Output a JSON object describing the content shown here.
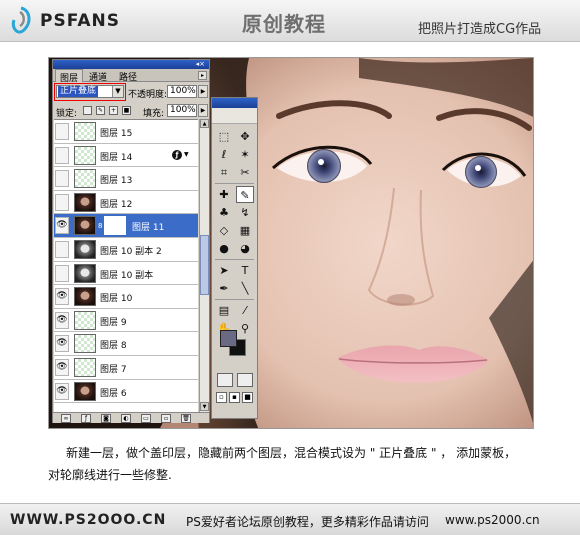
{
  "header": {
    "logo": "PSFANS",
    "title": "原创教程",
    "subtitle": "把照片打造成CG作品"
  },
  "layers_panel": {
    "tabs": [
      "图层",
      "通道",
      "路径"
    ],
    "blend_mode": "正片叠底",
    "opacity_label": "不透明度:",
    "opacity_value": "100%",
    "lock_label": "锁定:",
    "fill_label": "填充:",
    "fill_value": "100%",
    "layers": [
      {
        "name": "图层 15",
        "visible": false,
        "thumb": "checker",
        "selected": false
      },
      {
        "name": "图层 14",
        "visible": false,
        "thumb": "checker",
        "selected": false,
        "has_fx": true
      },
      {
        "name": "图层 13",
        "visible": false,
        "thumb": "checker",
        "selected": false
      },
      {
        "name": "图层 12",
        "visible": false,
        "thumb": "portrait",
        "selected": false
      },
      {
        "name": "图层 11",
        "visible": true,
        "thumb": "portrait",
        "selected": true,
        "has_mask": true
      },
      {
        "name": "图层 10 副本 2",
        "visible": false,
        "thumb": "gray",
        "selected": false
      },
      {
        "name": "图层 10 副本",
        "visible": false,
        "thumb": "gray",
        "selected": false
      },
      {
        "name": "图层 10",
        "visible": true,
        "thumb": "portrait",
        "selected": false
      },
      {
        "name": "图层 9",
        "visible": true,
        "thumb": "checker",
        "selected": false
      },
      {
        "name": "图层 8",
        "visible": true,
        "thumb": "checker",
        "selected": false
      },
      {
        "name": "图层 7",
        "visible": true,
        "thumb": "checker",
        "selected": false
      },
      {
        "name": "图层 6",
        "visible": true,
        "thumb": "portrait",
        "selected": false
      }
    ],
    "bottom_icons": [
      "link-icon",
      "fx-icon",
      "mask-icon",
      "adjustment-icon",
      "group-icon",
      "new-layer-icon",
      "trash-icon"
    ]
  },
  "caption": {
    "line1": "新建一层，做个盖印层，隐藏前两个图层，混合模式设为 \" 正片叠底 \" ， 添加蒙板，",
    "line2": "对轮廓线进行一些修整."
  },
  "footer": {
    "left": "WWW.PS2OOO.CN",
    "middle": "PS爱好者论坛原创教程，更多精彩作品请访问",
    "right": "www.ps2000.cn"
  }
}
